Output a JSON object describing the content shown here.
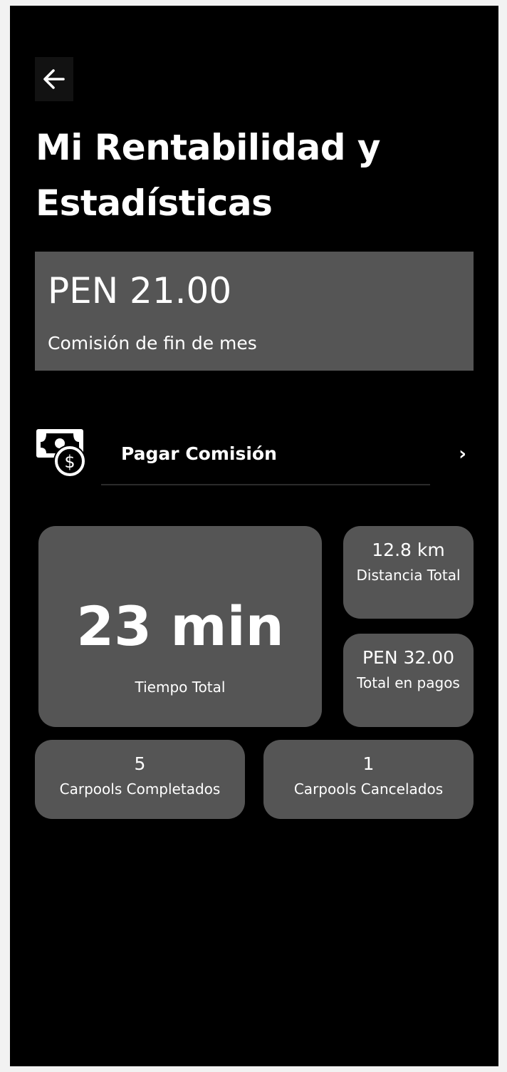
{
  "header": {
    "title": "Mi Rentabilidad y Estadísticas"
  },
  "commission": {
    "amount": "PEN 21.00",
    "label": "Comisión de fin de mes"
  },
  "pay_action": {
    "label": "Pagar Comisión",
    "chevron": "›"
  },
  "stats": {
    "total_time": {
      "value": "23 min",
      "label": "Tiempo Total"
    },
    "total_distance": {
      "value": "12.8 km",
      "label": "Distancia Total"
    },
    "total_payments": {
      "value": "PEN 32.00",
      "label": "Total en pagos"
    },
    "carpools_completed": {
      "value": "5",
      "label": "Carpools Completados"
    },
    "carpools_cancelled": {
      "value": "1",
      "label": "Carpools Cancelados"
    }
  },
  "icons": {
    "back": "arrow-left-icon",
    "pay": "money-dollar-icon"
  },
  "colors": {
    "background": "#000000",
    "card": "#555555",
    "text": "#ffffff"
  }
}
